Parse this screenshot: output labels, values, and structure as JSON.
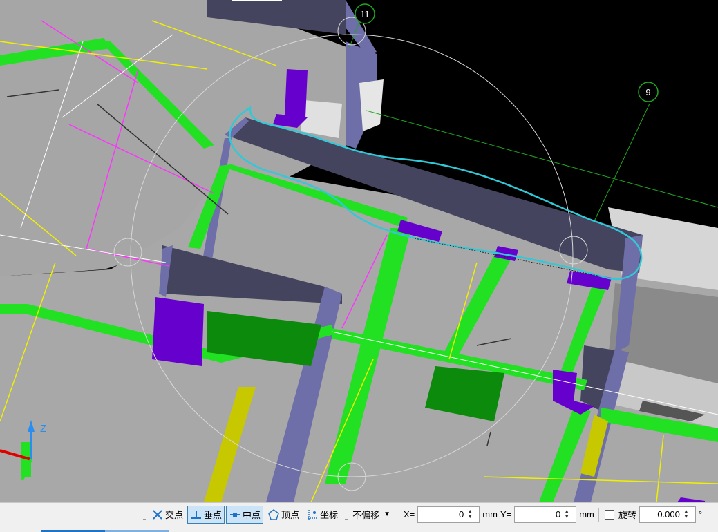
{
  "viewport": {
    "axis_labels": [
      "11",
      "9"
    ],
    "gizmo_z_label": "Z"
  },
  "snapbar": {
    "intersection_label": "交点",
    "perpendicular_label": "垂点",
    "midpoint_label": "中点",
    "vertex_label": "顶点",
    "coordinate_label": "坐标",
    "offset_mode_value": "不偏移",
    "x_label": "X=",
    "x_value": "0",
    "x_unit": "mm",
    "y_label": "Y=",
    "y_value": "0",
    "y_unit": "mm",
    "rotate_label": "旋转",
    "rotate_value": "0.000",
    "rotate_unit": "°"
  },
  "colors": {
    "background": "#000000",
    "floor": "#a8a8a8",
    "wall": "#44445e",
    "wall_edge": "#6e6ea8",
    "beam": "#22e022",
    "column": "#6600cc",
    "annotation": "#31c8d8"
  }
}
